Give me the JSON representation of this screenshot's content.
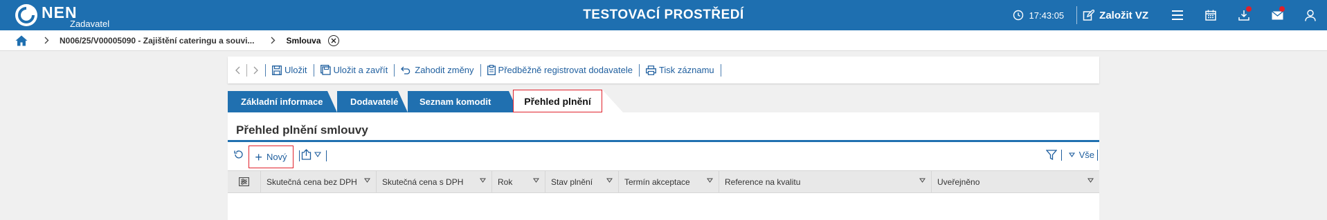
{
  "topbar": {
    "logo_text": "NEN",
    "logo_subtitle": "Zadavatel",
    "title": "TESTOVACÍ PROSTŘEDÍ",
    "time": "17:43:05",
    "create_vz_label": "Založit VZ",
    "icons": [
      "clock-icon",
      "edit-icon",
      "menu-icon",
      "calendar-icon",
      "download-icon",
      "mail-icon",
      "user-icon"
    ],
    "colors": {
      "bar": "#1e6fb0",
      "notification_dot": "#e0202a"
    }
  },
  "breadcrumb": {
    "items": [
      {
        "label": "N006/25/V00005090 - Zajištění cateringu a souvi..."
      },
      {
        "label": "Smlouva"
      }
    ]
  },
  "toolbar": {
    "save_label": "Uložit",
    "save_close_label": "Uložit a zavřít",
    "discard_label": "Zahodit změny",
    "preregister_label": "Předběžně registrovat dodavatele",
    "print_label": "Tisk záznamu"
  },
  "tabs": [
    {
      "label": "Základní informace",
      "active": false
    },
    {
      "label": "Dodavatelé",
      "active": false
    },
    {
      "label": "Seznam komodit",
      "active": false
    },
    {
      "label": "Přehled plnění",
      "active": true
    }
  ],
  "section": {
    "title": "Přehled plnění smlouvy",
    "new_label": "Nový",
    "filter_all_label": "Vše"
  },
  "table": {
    "columns": [
      "Skutečná cena bez DPH",
      "Skutečná cena s DPH",
      "Rok",
      "Stav plnění",
      "Termín akceptace",
      "Reference na kvalitu",
      "Uveřejněno"
    ],
    "rows": []
  }
}
